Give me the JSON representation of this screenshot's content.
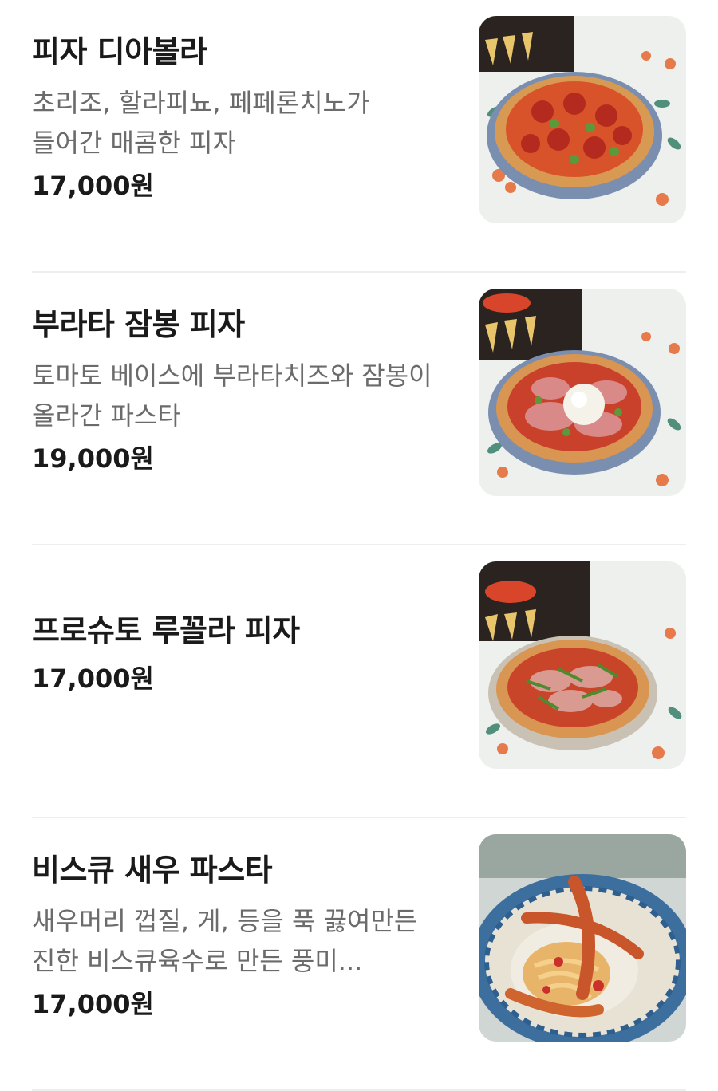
{
  "menu": {
    "items": [
      {
        "name": "피자 디아볼라",
        "description": "초리조, 할라피뇨, 페페론치노가 들어간 매콤한 피자",
        "price": "17,000원",
        "image_icon": "pizza-diavola-photo"
      },
      {
        "name": "부라타 잠봉 피자",
        "description": "토마토 베이스에 부라타치즈와 잠봉이 올라간 파스타",
        "price": "19,000원",
        "image_icon": "burrata-jambon-pizza-photo"
      },
      {
        "name": "프로슈토 루꼴라 피자",
        "description": "",
        "price": "17,000원",
        "image_icon": "prosciutto-rucola-pizza-photo"
      },
      {
        "name": "비스큐 새우 파스타",
        "description": "새우머리 껍질, 게, 등을 푹 끓여만든 진한 비스큐육수로 만든 풍미...",
        "price": "17,000원",
        "image_icon": "bisque-shrimp-pasta-photo"
      }
    ]
  }
}
